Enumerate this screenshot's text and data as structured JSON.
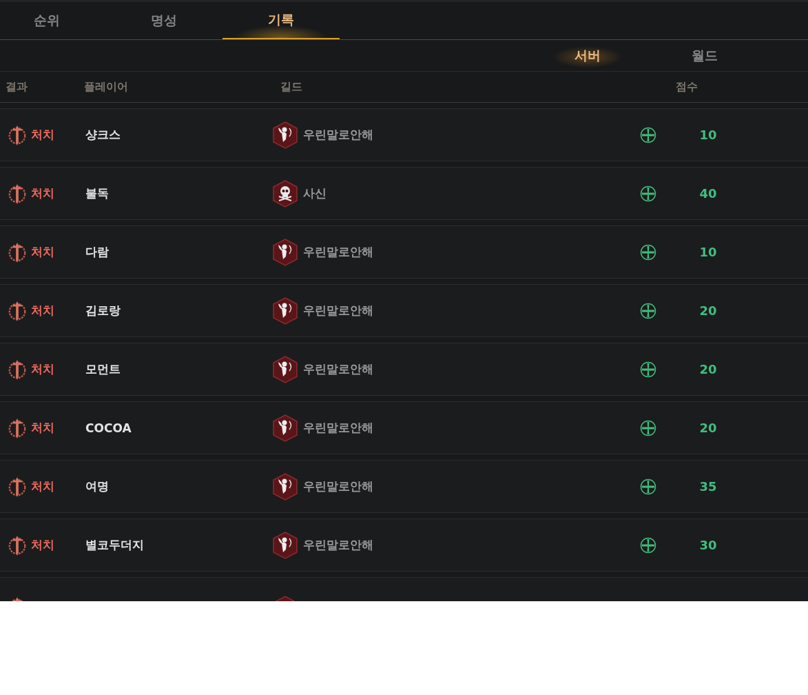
{
  "tabs": [
    {
      "label": "순위",
      "selected": false
    },
    {
      "label": "명성",
      "selected": false
    },
    {
      "label": "기록",
      "selected": true
    }
  ],
  "scope_tabs": [
    {
      "label": "서버",
      "selected": true
    },
    {
      "label": "월드",
      "selected": false
    }
  ],
  "table": {
    "columns": [
      "결과",
      "플레이어",
      "길드",
      "점수"
    ],
    "rows": [
      {
        "result": "처치",
        "player": "샹크스",
        "guild": "우린말로안해",
        "kind": "cupid",
        "score": "10"
      },
      {
        "result": "처치",
        "player": "불독",
        "guild": "사신",
        "kind": "skull",
        "score": "40"
      },
      {
        "result": "처치",
        "player": "다람",
        "guild": "우린말로안해",
        "kind": "cupid",
        "score": "10"
      },
      {
        "result": "처치",
        "player": "김로랑",
        "guild": "우린말로안해",
        "kind": "cupid",
        "score": "20"
      },
      {
        "result": "처치",
        "player": "모먼트",
        "guild": "우린말로안해",
        "kind": "cupid",
        "score": "20"
      },
      {
        "result": "처치",
        "player": "COCOA",
        "guild": "우린말로안해",
        "kind": "cupid",
        "score": "20"
      },
      {
        "result": "처치",
        "player": "여명",
        "guild": "우린말로안해",
        "kind": "cupid",
        "score": "35"
      },
      {
        "result": "처치",
        "player": "별코두더지",
        "guild": "우린말로안해",
        "kind": "cupid",
        "score": "30"
      }
    ]
  }
}
